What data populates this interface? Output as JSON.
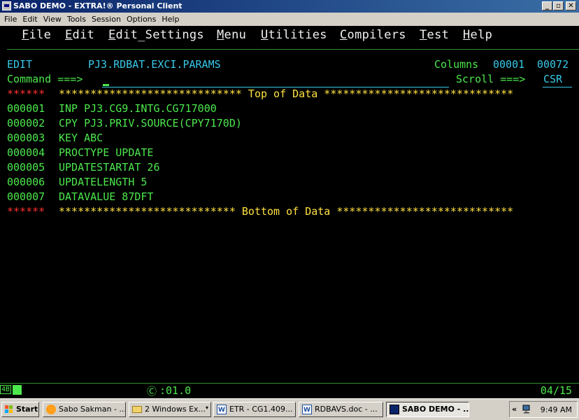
{
  "window": {
    "title": "SABO DEMO - EXTRA!® Personal Client",
    "minimize": "_",
    "maximize": "▫",
    "close": "✕"
  },
  "menubar": [
    "File",
    "Edit",
    "View",
    "Tools",
    "Session",
    "Options",
    "Help"
  ],
  "ispf_menu": [
    {
      "hot": "F",
      "rest": "ile"
    },
    {
      "hot": "E",
      "rest": "dit"
    },
    {
      "hot": "E",
      "rest": "dit_Settings"
    },
    {
      "hot": "M",
      "rest": "enu"
    },
    {
      "hot": "U",
      "rest": "tilities"
    },
    {
      "hot": "C",
      "rest": "ompilers"
    },
    {
      "hot": "T",
      "rest": "est"
    },
    {
      "hot": "H",
      "rest": "elp"
    }
  ],
  "header": {
    "mode": "EDIT",
    "dataset": "PJ3.RDBAT.EXCI.PARAMS",
    "columns_label": "Columns",
    "columns_from": "00001",
    "columns_to": "00072",
    "command_label": "Command ===>",
    "command_value": "",
    "scroll_label": "Scroll ===>",
    "scroll_value": "CSR"
  },
  "top_marker": {
    "prefix": "******",
    "line": "***************************** Top of Data ******************************"
  },
  "lines": [
    {
      "num": "000001",
      "text": "INP PJ3.CG9.INTG.CG717000"
    },
    {
      "num": "000002",
      "text": "CPY PJ3.PRIV.SOURCE(CPY7170D)"
    },
    {
      "num": "000003",
      "text": "KEY ABC"
    },
    {
      "num": "000004",
      "text": "PROCTYPE UPDATE"
    },
    {
      "num": "000005",
      "text": "UPDATESTARTAT 26"
    },
    {
      "num": "000006",
      "text": "UPDATELENGTH 5"
    },
    {
      "num": "000007",
      "text": "DATAVALUE 87DFT"
    }
  ],
  "bottom_marker": {
    "prefix": "******",
    "line": "**************************** Bottom of Data ****************************"
  },
  "status": {
    "session": "4B",
    "clock_icon": "Ⓒ",
    "time": ":01.0",
    "position": "04/15"
  },
  "taskbar": {
    "start": "Start",
    "buttons": [
      {
        "icon": "browser-icon",
        "label": "Sabo Sakman - ..."
      },
      {
        "icon": "folder-icon",
        "label": "2 Windows Ex...",
        "dropdown": "▾"
      },
      {
        "icon": "word-doc-icon",
        "label": "ETR - CG1.409..."
      },
      {
        "icon": "word-doc-icon",
        "label": "RDBAVS.doc - ..."
      },
      {
        "icon": "terminal-icon",
        "label": "SABO DEMO - ...",
        "active": true
      }
    ],
    "tray_chevron": "«",
    "clock": "9:49 AM"
  }
}
